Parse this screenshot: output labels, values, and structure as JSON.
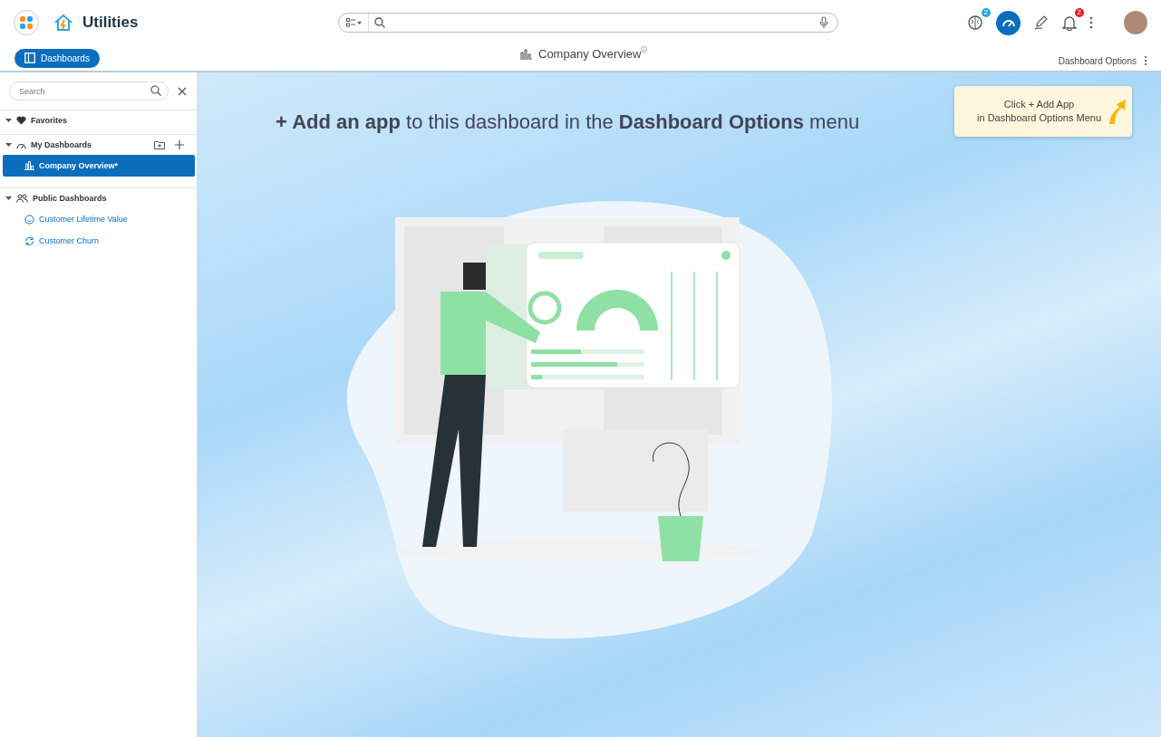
{
  "app": {
    "title": "Utilities"
  },
  "header": {
    "brain_badge": "2",
    "notification_badge": "2"
  },
  "toolbar": {
    "dashboards_button": "Dashboards",
    "page_title": "Company Overview",
    "options_label": "Dashboard Options"
  },
  "sidebar": {
    "search": {
      "placeholder": "Search"
    },
    "sections": [
      {
        "label": "Favorites",
        "expanded": true
      },
      {
        "label": "My Dashboards",
        "expanded": true,
        "items": [
          {
            "label": "Company Overview*",
            "selected": true
          }
        ]
      },
      {
        "label": "Public Dashboards",
        "expanded": true,
        "items": [
          {
            "label": "Customer Lifetime Value",
            "selected": false
          },
          {
            "label": "Customer Churn",
            "selected": false
          }
        ]
      }
    ]
  },
  "empty_state": {
    "message": "**+ Add an app** to this dashboard in the **Dashboard Options** menu"
  },
  "hint": {
    "text": "Click + Add App\nin Dashboard Options Menu"
  }
}
